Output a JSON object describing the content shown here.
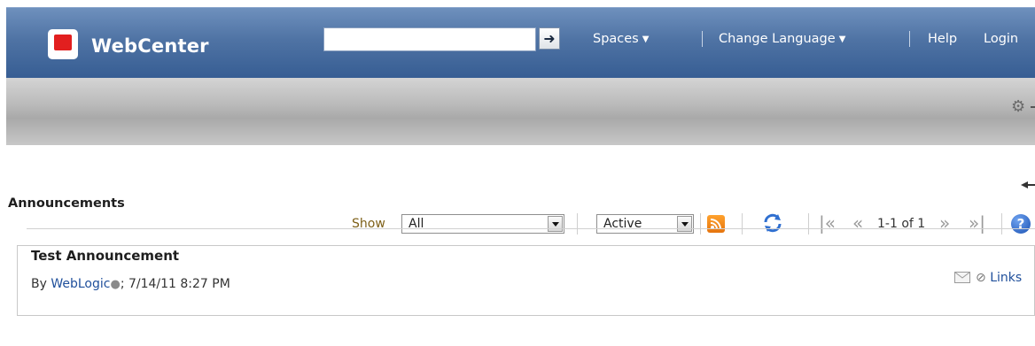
{
  "header": {
    "brand": "WebCenter",
    "search": {
      "value": "",
      "placeholder": ""
    },
    "nav": {
      "spaces": "Spaces",
      "change_language": "Change Language",
      "help": "Help",
      "login": "Login"
    },
    "colors": {
      "bar": "#4f73a4",
      "logo_red": "#e21f1f"
    }
  },
  "announcements": {
    "heading": "Announcements",
    "toolbar": {
      "show_label": "Show",
      "show_value": "All",
      "status_value": "Active",
      "pager_text": "1-1 of 1"
    },
    "items": [
      {
        "title": "Test Announcement",
        "by_prefix": "By",
        "author": "WebLogic",
        "date": "; 7/14/11 8:27 PM",
        "links_label": "Links"
      }
    ]
  },
  "icons": [
    "logo-icon",
    "arrow-right-icon",
    "chevron-down-icon",
    "gear-icon",
    "rss-icon",
    "refresh-icon",
    "first-page-icon",
    "prev-page-icon",
    "next-page-icon",
    "last-page-icon",
    "help-icon",
    "presence-icon",
    "mail-icon",
    "links-icon"
  ]
}
